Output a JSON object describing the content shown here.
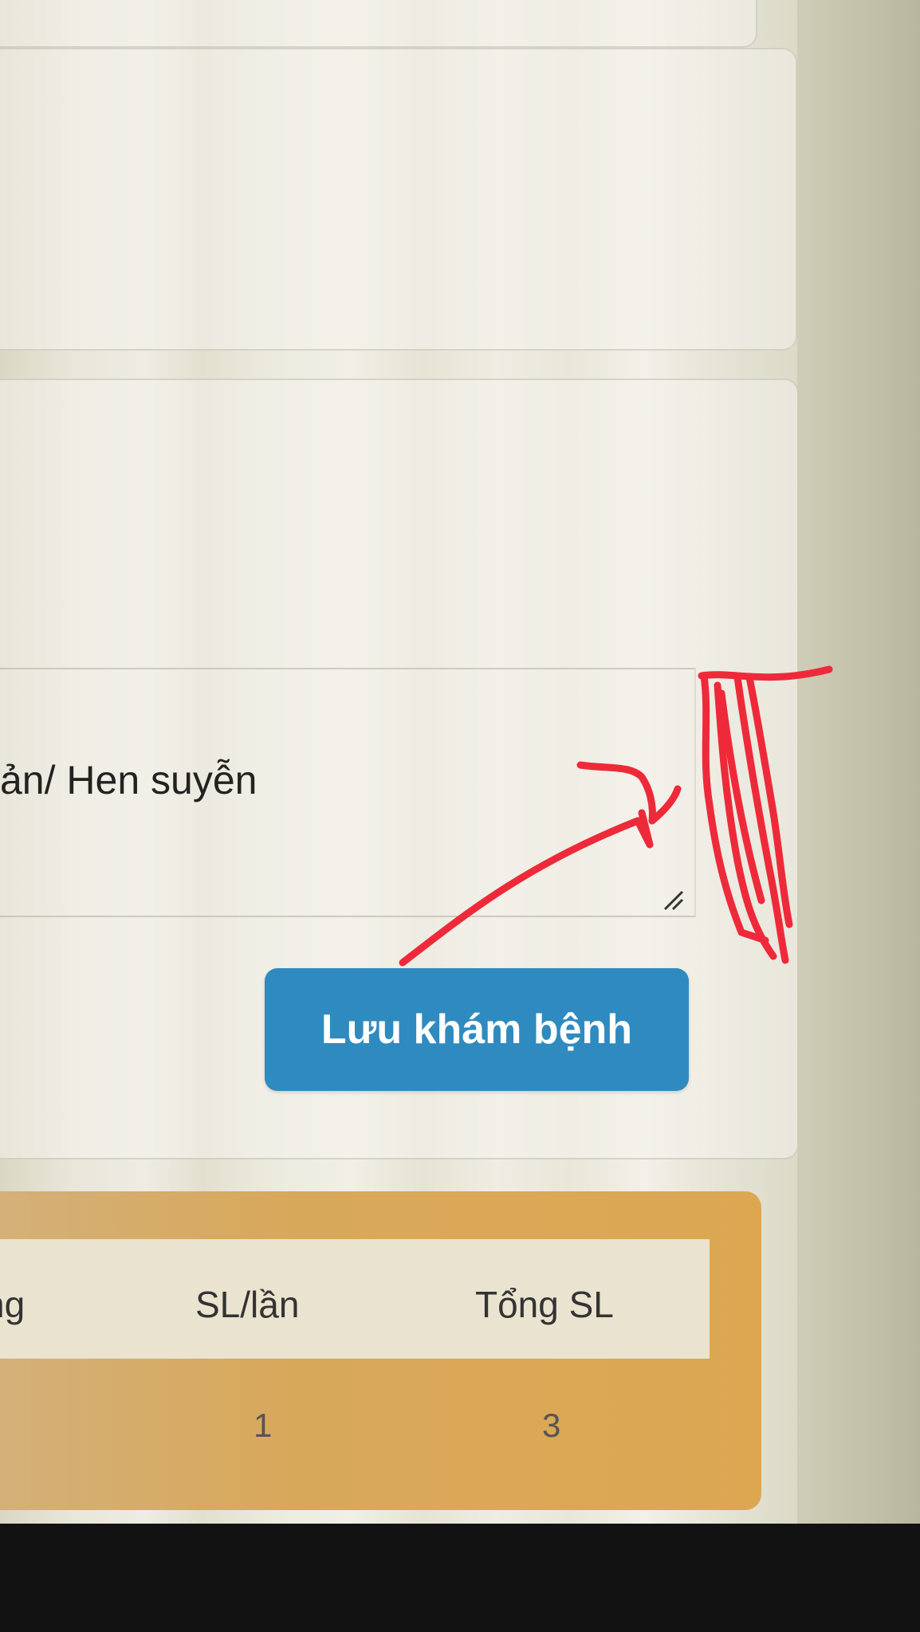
{
  "form": {
    "textarea_value": "ản/ Hen suyễn",
    "save_button_label": "Lưu khám bệnh"
  },
  "table": {
    "headers": [
      "ng",
      "SL/lần",
      "Tổng SL"
    ],
    "rows": [
      [
        "",
        "1",
        "3"
      ]
    ]
  },
  "annotation": {
    "stroke_color": "#ee2a3a"
  }
}
